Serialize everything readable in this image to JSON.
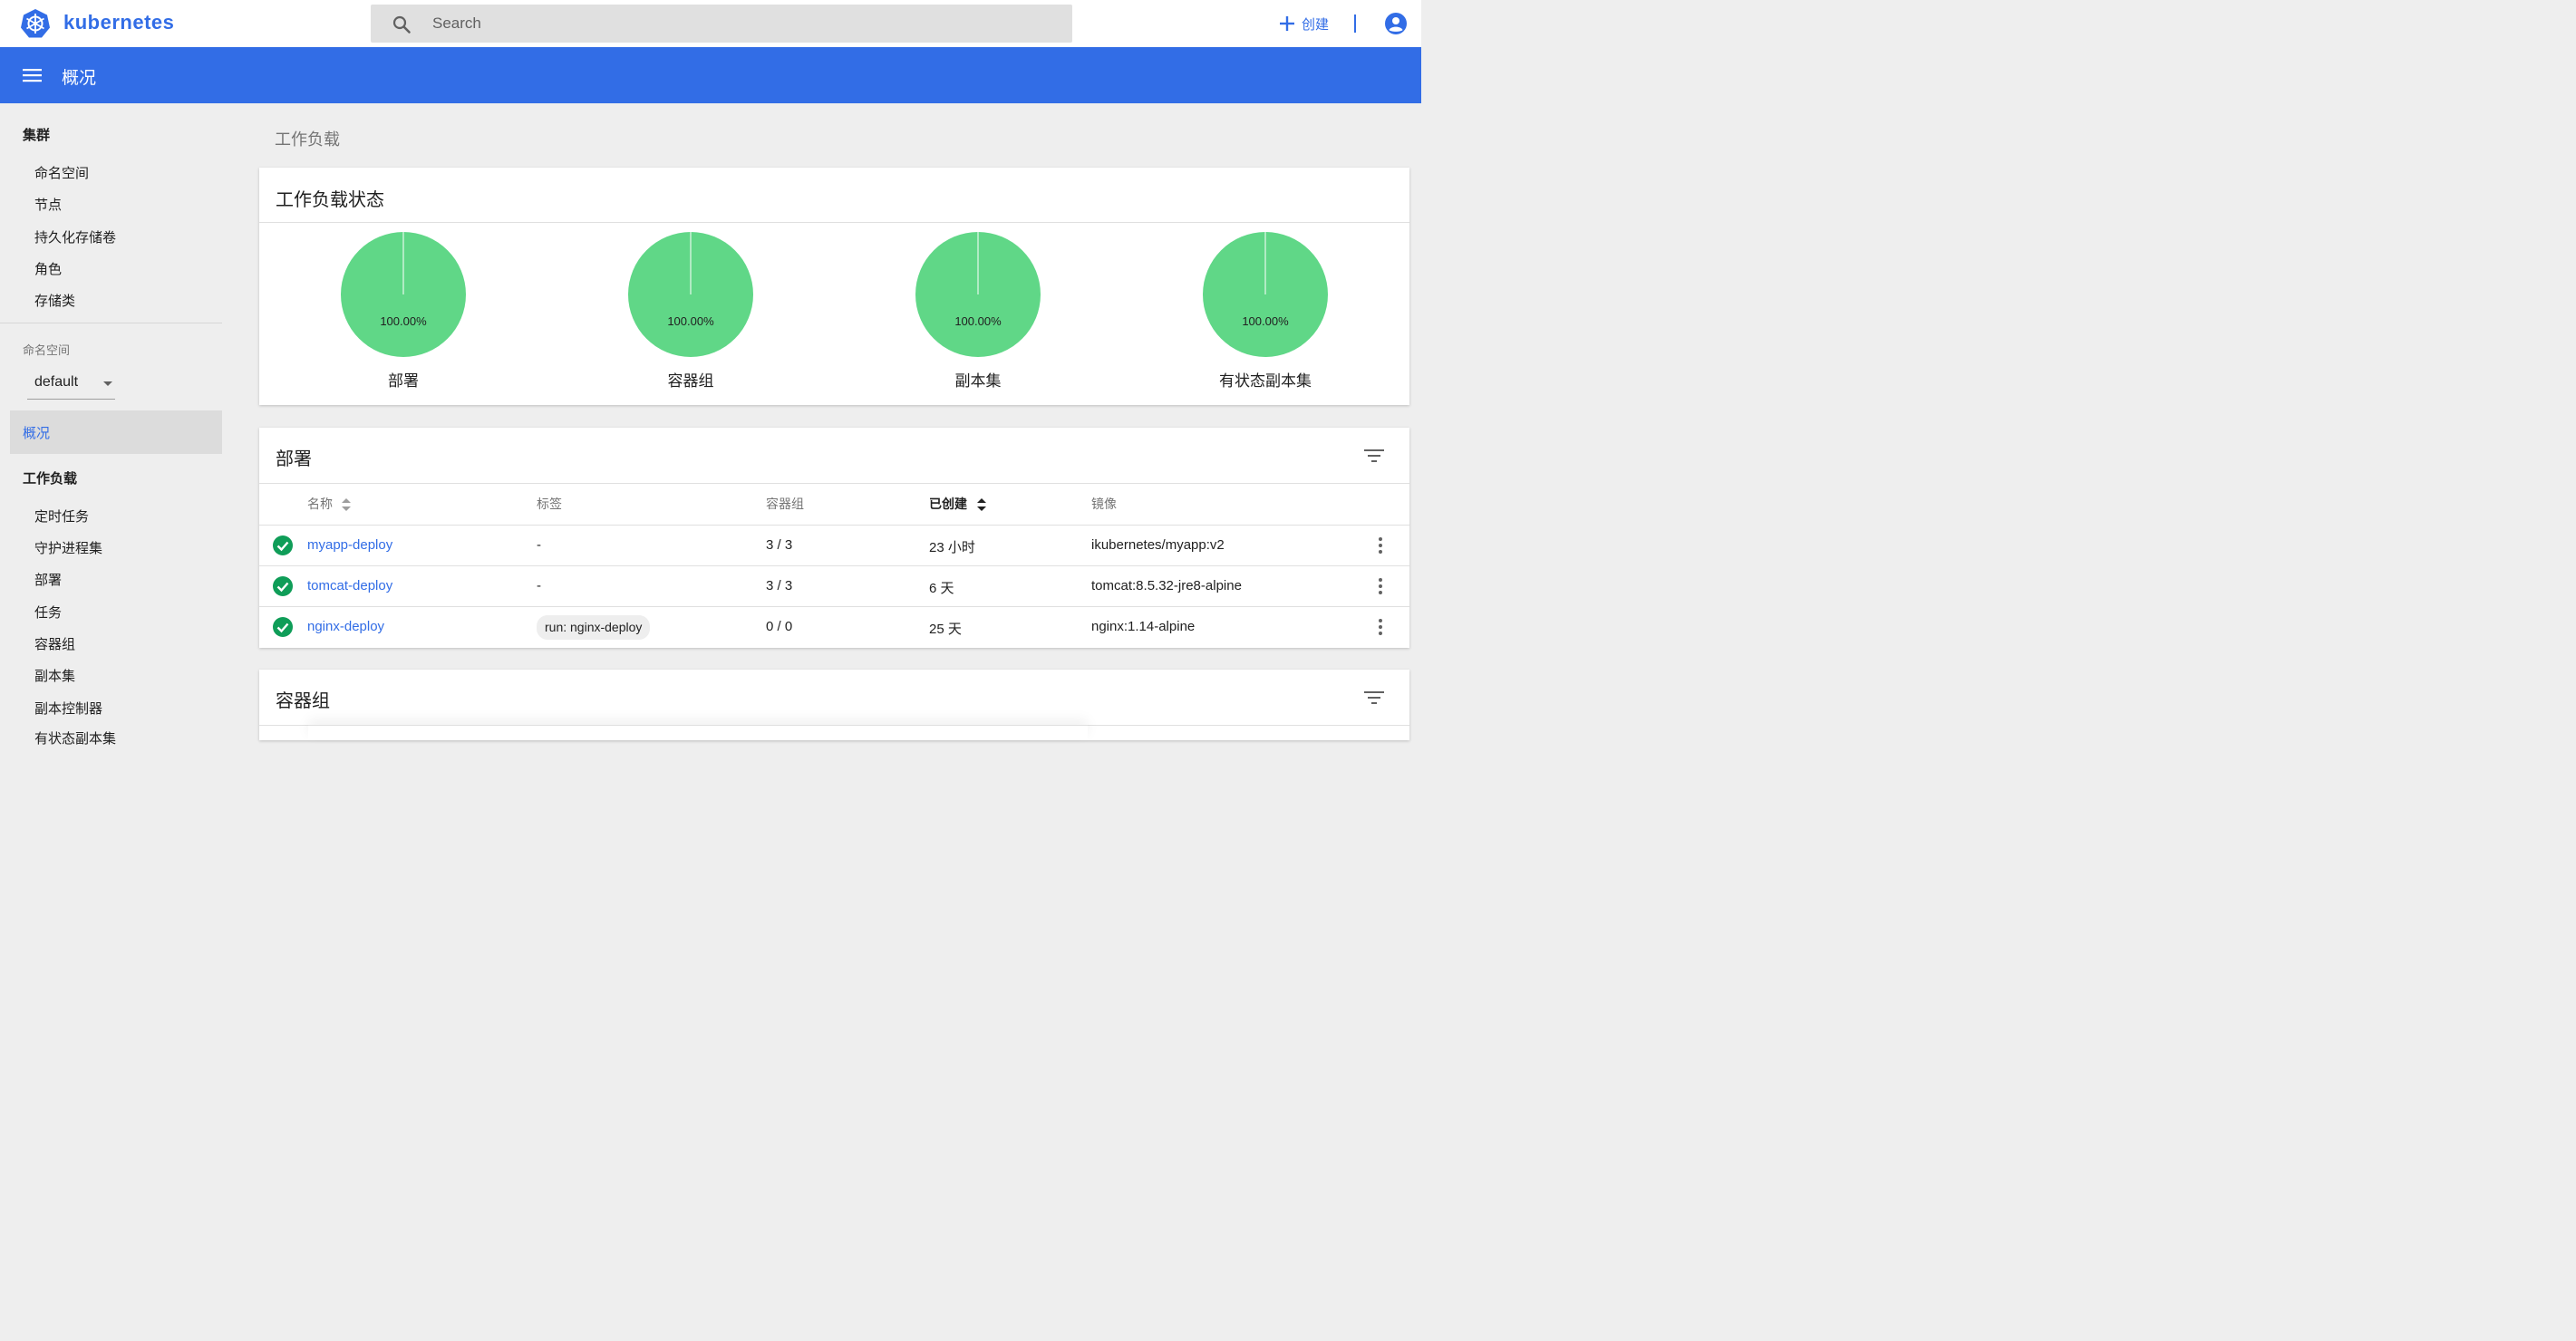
{
  "topbar": {
    "brand": "kubernetes",
    "search_placeholder": "Search",
    "create_label": "创建"
  },
  "appbar": {
    "title": "概况"
  },
  "sidebar": {
    "cluster_heading": "集群",
    "cluster_items": [
      "命名空间",
      "节点",
      "持久化存储卷",
      "角色",
      "存储类"
    ],
    "namespace_label": "命名空间",
    "namespace_value": "default",
    "active_item": "概况",
    "workloads_heading": "工作负载",
    "workload_items": [
      "定时任务",
      "守护进程集",
      "部署",
      "任务",
      "容器组",
      "副本集",
      "副本控制器",
      "有状态副本集"
    ]
  },
  "main": {
    "breadcrumb": "工作负载",
    "status_card": {
      "title": "工作负载状态",
      "pies": [
        {
          "label": "部署",
          "percent_text": "100.00%",
          "value": 100
        },
        {
          "label": "容器组",
          "percent_text": "100.00%",
          "value": 100
        },
        {
          "label": "副本集",
          "percent_text": "100.00%",
          "value": 100
        },
        {
          "label": "有状态副本集",
          "percent_text": "100.00%",
          "value": 100
        }
      ]
    },
    "deploy_card": {
      "title": "部署",
      "columns": [
        "名称",
        "标签",
        "容器组",
        "已创建",
        "镜像"
      ],
      "rows": [
        {
          "name": "myapp-deploy",
          "labels": "-",
          "pods": "3 / 3",
          "created": "23 小时",
          "image": "ikubernetes/myapp:v2"
        },
        {
          "name": "tomcat-deploy",
          "labels": "-",
          "pods": "3 / 3",
          "created": "6 天",
          "image": "tomcat:8.5.32-jre8-alpine"
        },
        {
          "name": "nginx-deploy",
          "labels": "run: nginx-deploy",
          "pods": "0 / 0",
          "created": "25 天",
          "image": "nginx:1.14-alpine"
        }
      ]
    },
    "pods_card": {
      "title": "容器组"
    }
  },
  "colors": {
    "accent": "#326de6",
    "success": "#0f9d58",
    "pie": "#60d787"
  }
}
